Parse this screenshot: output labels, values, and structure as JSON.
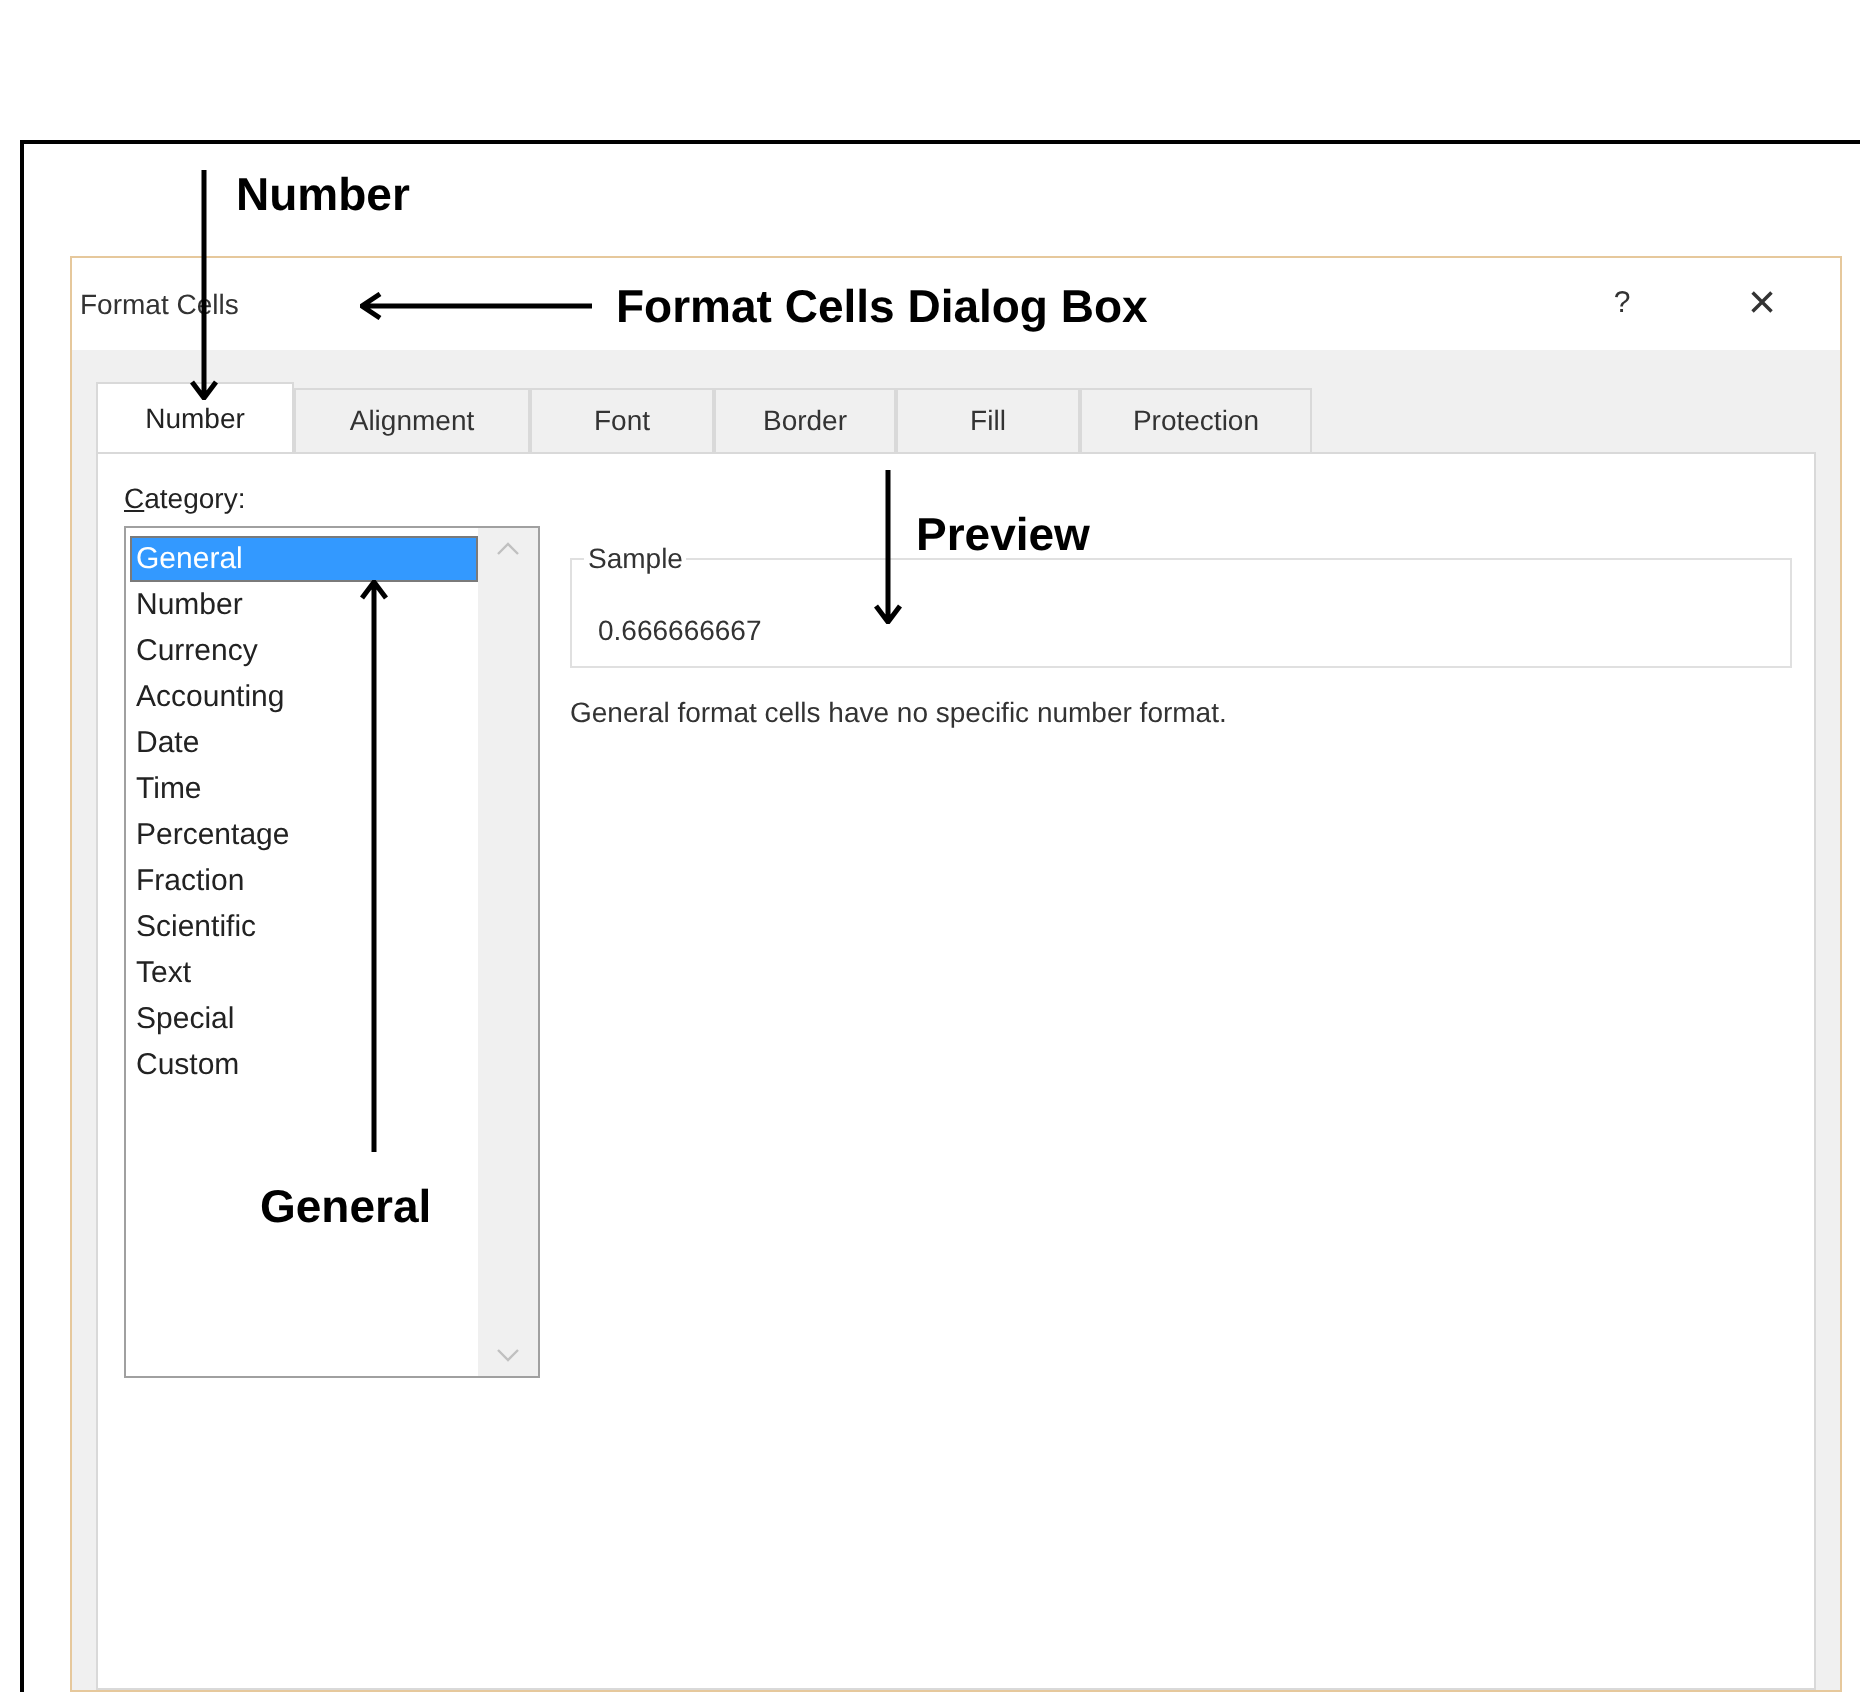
{
  "dialog": {
    "title": "Format Cells",
    "help": "?",
    "close": "×"
  },
  "tabs": [
    {
      "label": "Number",
      "selected": true
    },
    {
      "label": "Alignment",
      "selected": false
    },
    {
      "label": "Font",
      "selected": false
    },
    {
      "label": "Border",
      "selected": false
    },
    {
      "label": "Fill",
      "selected": false
    },
    {
      "label": "Protection",
      "selected": false
    }
  ],
  "category": {
    "label": "Category:",
    "items": [
      {
        "label": "General",
        "selected": true
      },
      {
        "label": "Number",
        "selected": false
      },
      {
        "label": "Currency",
        "selected": false
      },
      {
        "label": "Accounting",
        "selected": false
      },
      {
        "label": "Date",
        "selected": false
      },
      {
        "label": "Time",
        "selected": false
      },
      {
        "label": "Percentage",
        "selected": false
      },
      {
        "label": "Fraction",
        "selected": false
      },
      {
        "label": "Scientific",
        "selected": false
      },
      {
        "label": "Text",
        "selected": false
      },
      {
        "label": "Special",
        "selected": false
      },
      {
        "label": "Custom",
        "selected": false
      }
    ]
  },
  "sample": {
    "legend": "Sample",
    "value": "0.666666667"
  },
  "description": "General format cells have no specific number format.",
  "annotations": [
    {
      "text": "Number",
      "kind": "down"
    },
    {
      "text": "Format Cells Dialog Box",
      "kind": "left"
    },
    {
      "text": "Preview",
      "kind": "down"
    },
    {
      "text": "General",
      "kind": "up"
    }
  ]
}
